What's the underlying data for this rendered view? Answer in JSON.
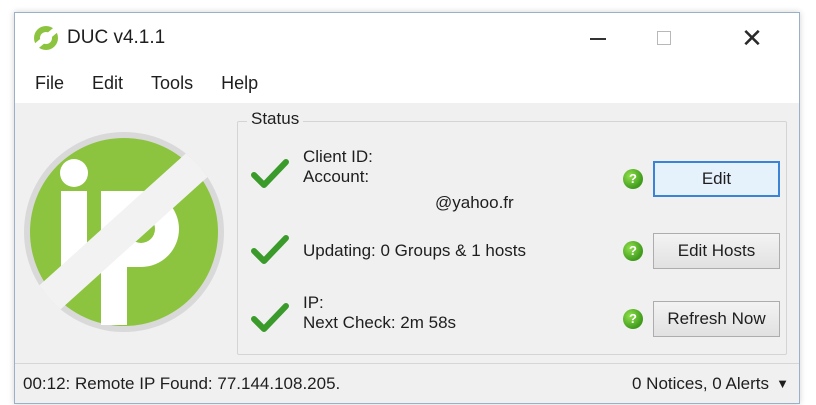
{
  "window": {
    "title": "DUC v4.1.1",
    "controls": {
      "minimize": "—",
      "close": "✕"
    }
  },
  "menu": [
    "File",
    "Edit",
    "Tools",
    "Help"
  ],
  "status": {
    "legend": "Status",
    "rows": [
      {
        "lines": [
          "Client ID:",
          "Account:"
        ],
        "extra": "@yahoo.fr",
        "button": "Edit",
        "help": "?"
      },
      {
        "lines": [
          "Updating: 0 Groups & 1 hosts"
        ],
        "button": "Edit Hosts",
        "help": "?"
      },
      {
        "lines": [
          "IP:",
          "Next Check: 2m 58s"
        ],
        "button": "Refresh Now",
        "help": "?"
      }
    ]
  },
  "statusbar": {
    "message": "00:12: Remote IP Found: 77.144.108.205.",
    "notices": "0 Notices, 0 Alerts",
    "caret": "▼"
  },
  "colors": {
    "brand_green": "#8cc43f",
    "check_green": "#3a9a2a",
    "focus_blue": "#3a83d6"
  },
  "icons": {
    "app": "ip-logo-icon",
    "status": "checkmark-icon",
    "help": "help-icon"
  }
}
